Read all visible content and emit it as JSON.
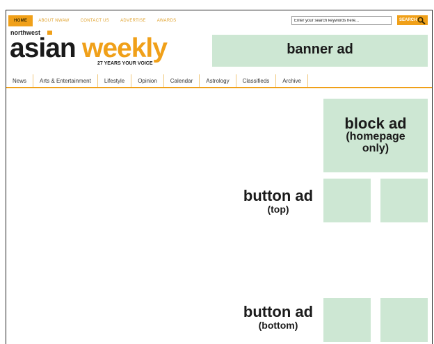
{
  "topnav": {
    "items": [
      {
        "label": "HOME",
        "active": true
      },
      {
        "label": "ABOUT NWAW",
        "active": false
      },
      {
        "label": "CONTACT US",
        "active": false
      },
      {
        "label": "ADVERTISE",
        "active": false
      },
      {
        "label": "AWARDS",
        "active": false
      }
    ]
  },
  "search": {
    "placeholder": "Enter your search keywords here...",
    "button_label": "SEARCH"
  },
  "logo": {
    "northwest": "northwest",
    "asian": "asian",
    "weekly": "weekly",
    "tagline": "27 YEARS YOUR VOICE"
  },
  "mainnav": {
    "tabs": [
      "News",
      "Arts & Entertainment",
      "Lifestyle",
      "Opinion",
      "Calendar",
      "Astrology",
      "Classifieds",
      "Archive"
    ]
  },
  "ads": {
    "banner": "banner ad",
    "block_line1": "block ad",
    "block_line2": "(homepage",
    "block_line3": "only)",
    "button_top_title": "button ad",
    "button_top_sub": "(top)",
    "button_bottom_title": "button ad",
    "button_bottom_sub": "(bottom)"
  },
  "colors": {
    "accent": "#f0a019",
    "ad_placeholder": "#cde7d3"
  }
}
